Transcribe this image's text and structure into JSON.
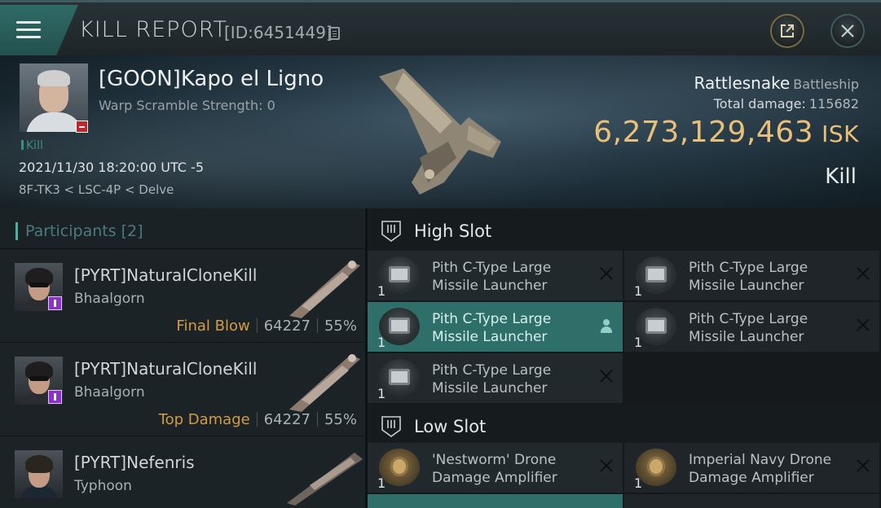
{
  "header": {
    "title": "KILL REPORT",
    "id_label": "[ID:6451449]"
  },
  "victim": {
    "name": "[GOON]Kapo el Ligno",
    "warp_scramble": "Warp Scramble Strength: 0",
    "kill_tag": "Kill",
    "timestamp": "2021/11/30 18:20:00 UTC -5",
    "location": "8F-TK3 < LSC-4P < Delve",
    "ship": "Rattlesnake",
    "ship_class": "Battleship",
    "total_damage_label": "Total damage:",
    "total_damage": "115682",
    "isk_value": "6,273,129,463",
    "isk_unit": "ISK",
    "result": "Kill"
  },
  "participants": {
    "title": "Participants [2]",
    "rows": [
      {
        "name": "[PYRT]NaturalCloneKill",
        "ship": "Bhaalgorn",
        "role": "Final Blow",
        "damage": "64227",
        "percent": "55%"
      },
      {
        "name": "[PYRT]NaturalCloneKill",
        "ship": "Bhaalgorn",
        "role": "Top Damage",
        "damage": "64227",
        "percent": "55%"
      },
      {
        "name": "[PYRT]Nefenris",
        "ship": "Typhoon",
        "role": "",
        "damage": "",
        "percent": ""
      }
    ]
  },
  "fitting": {
    "high_slot": {
      "label": "High Slot",
      "modules": [
        {
          "qty": "1",
          "name": "Pith C-Type Large Missile Launcher"
        },
        {
          "qty": "1",
          "name": "Pith C-Type Large Missile Launcher"
        },
        {
          "qty": "1",
          "name": "Pith C-Type Large Missile Launcher"
        },
        {
          "qty": "1",
          "name": "Pith C-Type Large Missile Launcher"
        },
        {
          "qty": "1",
          "name": "Pith C-Type Large Missile Launcher"
        }
      ]
    },
    "low_slot": {
      "label": "Low Slot",
      "modules": [
        {
          "qty": "1",
          "name": "'Nestworm' Drone Damage Amplifier"
        },
        {
          "qty": "1",
          "name": "Imperial Navy Drone Damage Amplifier"
        }
      ]
    }
  },
  "colors": {
    "accent": "#2e6f6a",
    "isk": "#e8c07a",
    "final_blow": "#d19c44"
  }
}
